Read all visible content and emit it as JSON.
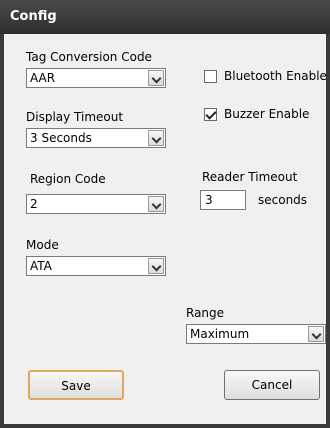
{
  "window": {
    "title": "Config"
  },
  "fields": {
    "tag_conversion": {
      "label": "Tag Conversion Code",
      "value": "AAR"
    },
    "display_timeout": {
      "label": "Display Timeout",
      "value": "3 Seconds"
    },
    "region_code": {
      "label": "Region Code",
      "value": "2"
    },
    "mode": {
      "label": "Mode",
      "value": "ATA"
    },
    "range": {
      "label": "Range",
      "value": "Maximum"
    },
    "reader_timeout": {
      "label": "Reader Timeout",
      "value": "3",
      "unit": "seconds"
    }
  },
  "checkboxes": {
    "bluetooth": {
      "label": "Bluetooth Enable",
      "checked": false
    },
    "buzzer": {
      "label": "Buzzer Enable",
      "checked": true
    }
  },
  "buttons": {
    "save": "Save",
    "cancel": "Cancel"
  }
}
